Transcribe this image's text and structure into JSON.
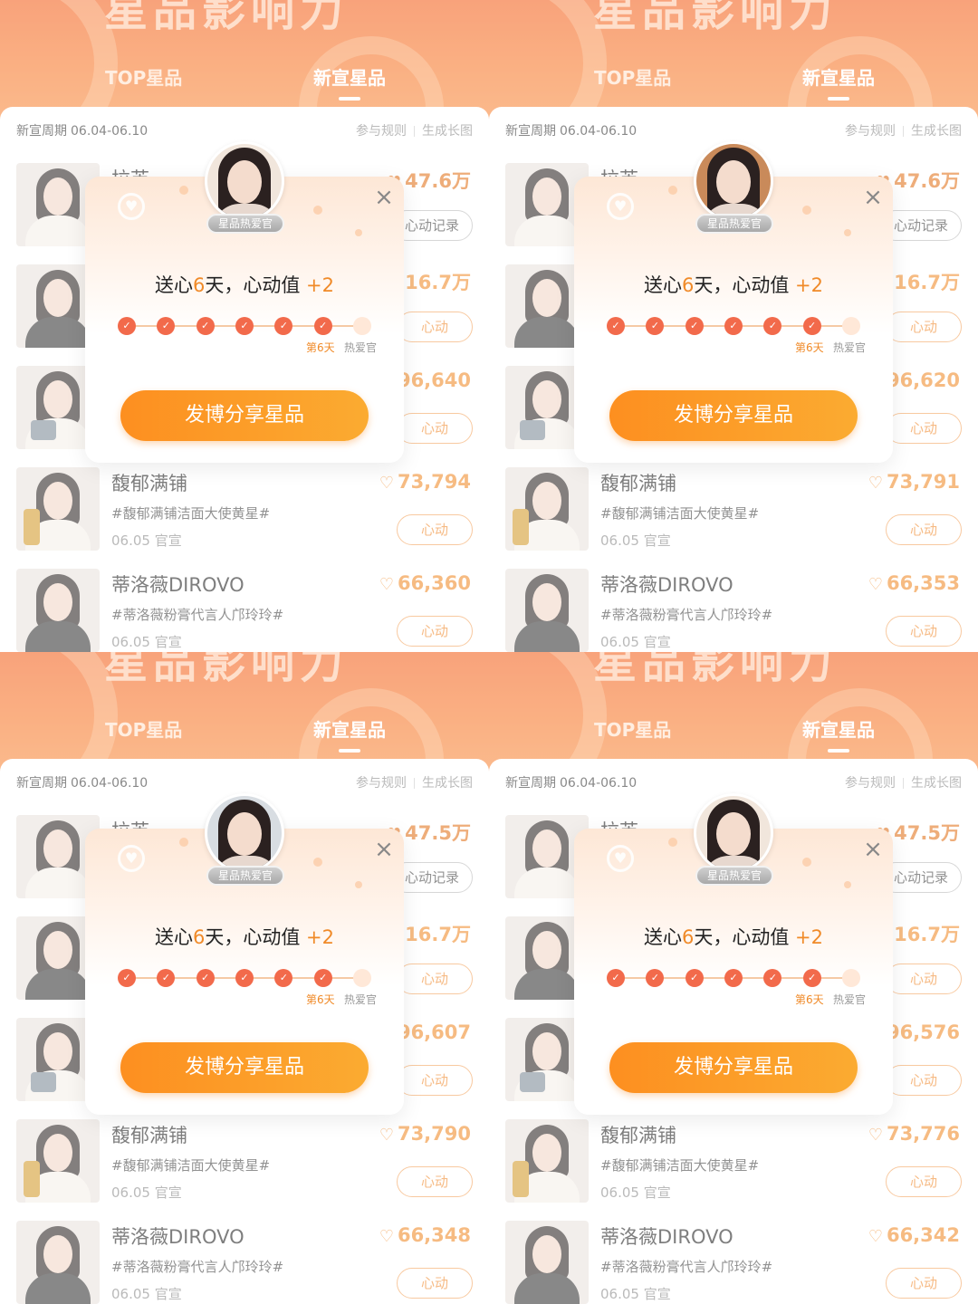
{
  "header": {
    "banner_title": "星品影响力",
    "tab_top": "TOP星品",
    "tab_new": "新宣星品",
    "cycle_label": "新宣周期",
    "cycle_range": "06.04-06.10",
    "rules_link": "参与规则",
    "longimage_link": "生成长图"
  },
  "icons": {
    "heart": "heart-icon",
    "close": "close-icon",
    "sparkle": "sparkle-icon",
    "check": "check-icon"
  },
  "colors": {
    "accent": "#f08a28",
    "hero": "#f3601c",
    "cta_start": "#fd8f20",
    "cta_end": "#fbab31",
    "node": "#f26a4b"
  },
  "modal": {
    "badge": "星品热爱官",
    "message_prefix": "送心",
    "days": "6",
    "message_mid": "天，心动值",
    "bonus": "+2",
    "day_progress_completed": 6,
    "day_progress_total": 7,
    "current_label": "第6天",
    "end_label": "热爱官",
    "cta": "发博分享星品",
    "close": "×"
  },
  "panels": [
    {
      "rows": [
        {
          "name": "拉芙",
          "score": "47.6万",
          "button": "心动记录"
        },
        {
          "name": "",
          "score": "16.7万",
          "button": "心动"
        },
        {
          "name": "",
          "score": "96,640",
          "button": "心动"
        },
        {
          "name": "馥郁满铺",
          "tag": "#馥郁满铺洁面大使黄星#",
          "date": "06.05 官宣",
          "score": "73,794",
          "button": "心动"
        },
        {
          "name": "蒂洛薇DIROVO",
          "tag": "#蒂洛薇粉膏代言人邝玲玲#",
          "date": "06.05 官宣",
          "score": "66,360",
          "button": "心动"
        }
      ]
    },
    {
      "rows": [
        {
          "name": "拉芙",
          "score": "47.6万",
          "button": "心动记录"
        },
        {
          "name": "",
          "score": "16.7万",
          "button": "心动"
        },
        {
          "name": "",
          "score": "96,620",
          "button": "心动"
        },
        {
          "name": "馥郁满铺",
          "tag": "#馥郁满铺洁面大使黄星#",
          "date": "06.05 官宣",
          "score": "73,791",
          "button": "心动"
        },
        {
          "name": "蒂洛薇DIROVO",
          "tag": "#蒂洛薇粉膏代言人邝玲玲#",
          "date": "06.05 官宣",
          "score": "66,353",
          "button": "心动"
        }
      ]
    },
    {
      "rows": [
        {
          "name": "拉芙",
          "score": "47.5万",
          "button": "心动记录"
        },
        {
          "name": "",
          "score": "16.7万",
          "button": "心动"
        },
        {
          "name": "",
          "score": "96,607",
          "button": "心动"
        },
        {
          "name": "馥郁满铺",
          "tag": "#馥郁满铺洁面大使黄星#",
          "date": "06.05 官宣",
          "score": "73,790",
          "button": "心动"
        },
        {
          "name": "蒂洛薇DIROVO",
          "tag": "#蒂洛薇粉膏代言人邝玲玲#",
          "date": "06.05 官宣",
          "score": "66,348",
          "button": "心动"
        }
      ]
    },
    {
      "rows": [
        {
          "name": "拉芙",
          "score": "47.5万",
          "button": "心动记录"
        },
        {
          "name": "",
          "score": "16.7万",
          "button": "心动"
        },
        {
          "name": "",
          "score": "96,576",
          "button": "心动"
        },
        {
          "name": "馥郁满铺",
          "tag": "#馥郁满铺洁面大使黄星#",
          "date": "06.05 官宣",
          "score": "73,776",
          "button": "心动"
        },
        {
          "name": "蒂洛薇DIROVO",
          "tag": "#蒂洛薇粉膏代言人邝玲玲#",
          "date": "06.05 官宣",
          "score": "66,342",
          "button": "心动"
        }
      ]
    }
  ]
}
